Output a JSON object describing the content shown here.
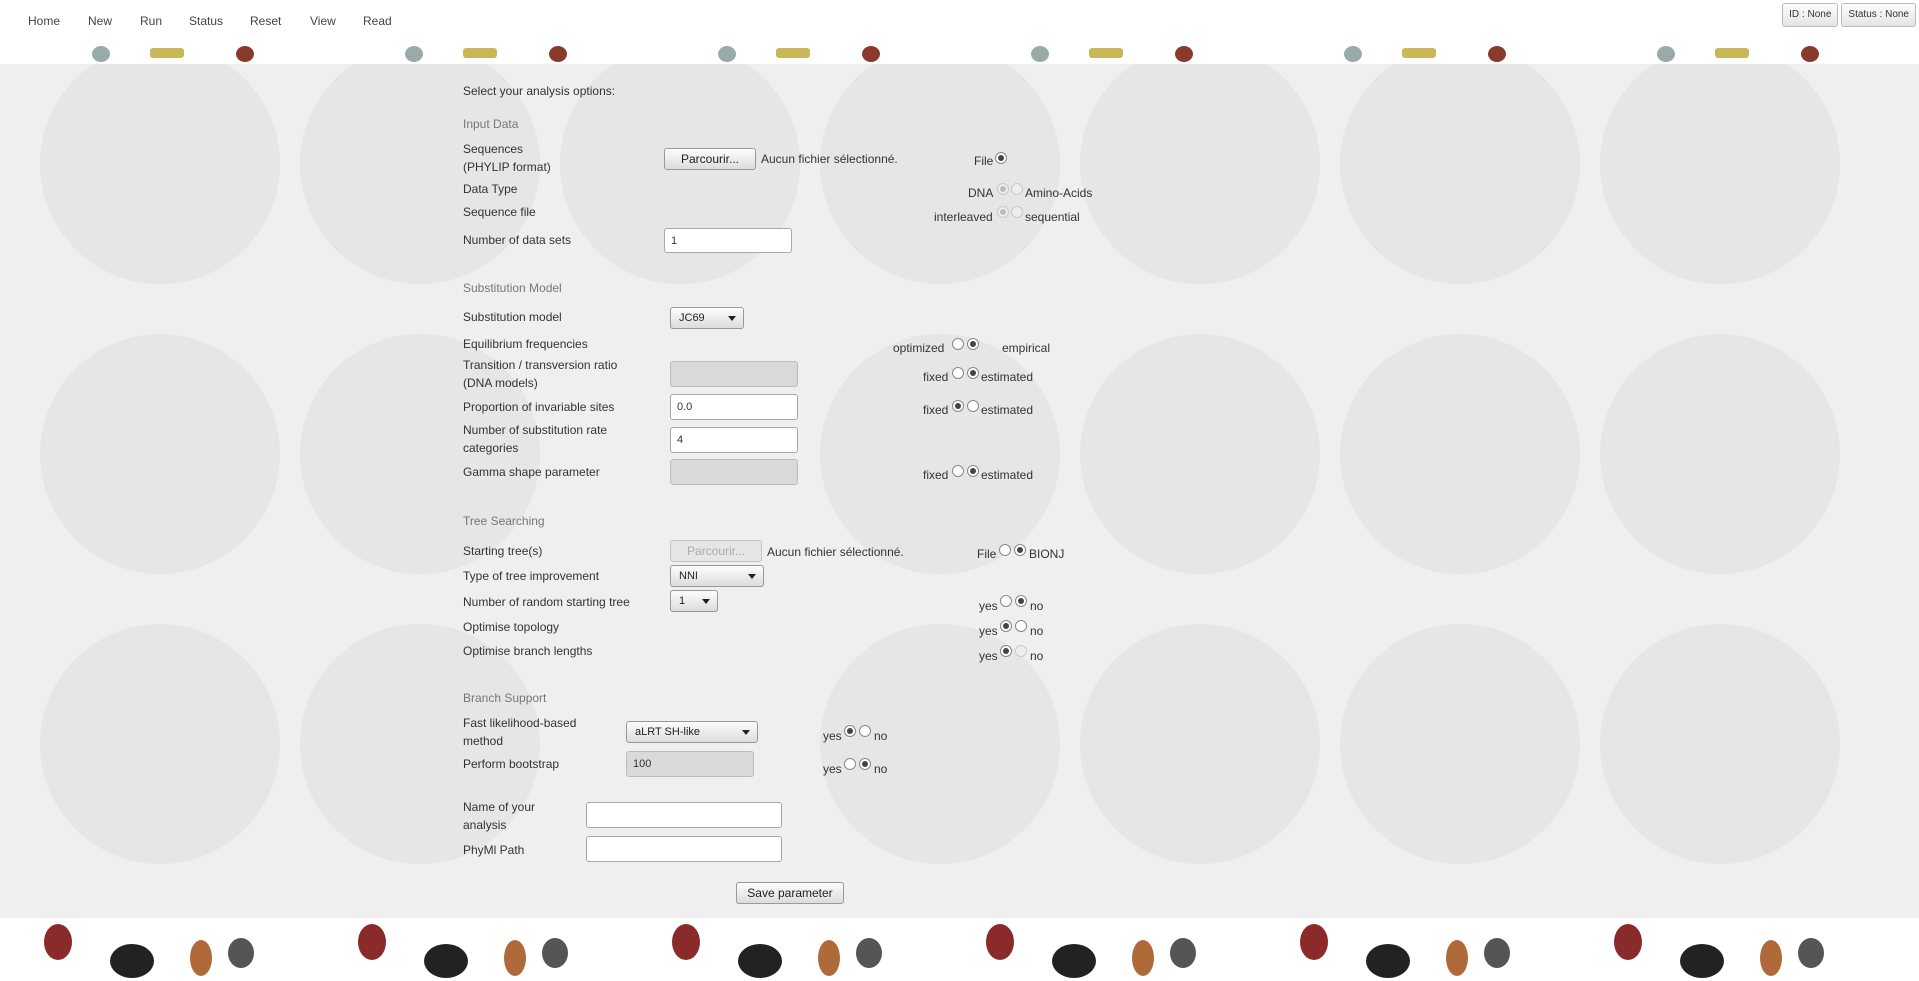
{
  "nav": {
    "items": [
      "Home",
      "New",
      "Run",
      "Status",
      "Reset",
      "View",
      "Read"
    ]
  },
  "badges": {
    "id": "ID : None",
    "status": "Status : None"
  },
  "form": {
    "intro": "Select your analysis options:",
    "input_data": {
      "section": "Input Data",
      "sequences_label_1": "Sequences",
      "sequences_label_2": "(PHYLIP format)",
      "browse_button": "Parcourir...",
      "no_file": "Aucun fichier sélectionné.",
      "file_option": "File",
      "data_type_label": "Data Type",
      "dna_option": "DNA",
      "aa_option": "Amino-Acids",
      "sequence_file_label": "Sequence file",
      "interleaved_option": "interleaved",
      "sequential_option": "sequential",
      "num_datasets_label": "Number of data sets",
      "num_datasets_value": "1"
    },
    "substitution": {
      "section": "Substitution Model",
      "model_label": "Substitution model",
      "model_value": "JC69",
      "eq_freq_label": "Equilibrium frequencies",
      "optimized_option": "optimized",
      "empirical_option": "empirical",
      "ts_tv_label_1": "Transition / transversion ratio",
      "ts_tv_label_2": "(DNA models)",
      "fixed_option": "fixed",
      "estimated_option": "estimated",
      "pinv_label": "Proportion of invariable sites",
      "pinv_value": "0.0",
      "ncat_label_1": "Number of substitution rate",
      "ncat_label_2": "categories",
      "ncat_value": "4",
      "gamma_label": "Gamma shape parameter"
    },
    "tree": {
      "section": "Tree Searching",
      "starting_label": "Starting tree(s)",
      "browse_button": "Parcourir...",
      "no_file": "Aucun fichier sélectionné.",
      "file_option": "File",
      "bionj_option": "BIONJ",
      "improvement_label": "Type of tree improvement",
      "improvement_value": "NNI",
      "random_label": "Number of random starting tree",
      "random_value": "1",
      "yes": "yes",
      "no": "no",
      "opt_topology_label": "Optimise topology",
      "opt_branch_label": "Optimise branch lengths"
    },
    "branch": {
      "section": "Branch Support",
      "fast_label_1": "Fast likelihood-based",
      "fast_label_2": "method",
      "fast_value": "aLRT SH-like",
      "bootstrap_label": "Perform bootstrap",
      "bootstrap_value": "100",
      "yes": "yes",
      "no": "no"
    },
    "analysis_name_label_1": "Name of your",
    "analysis_name_label_2": "analysis",
    "phyml_path_label": "PhyMl Path",
    "save_button": "Save parameter"
  }
}
